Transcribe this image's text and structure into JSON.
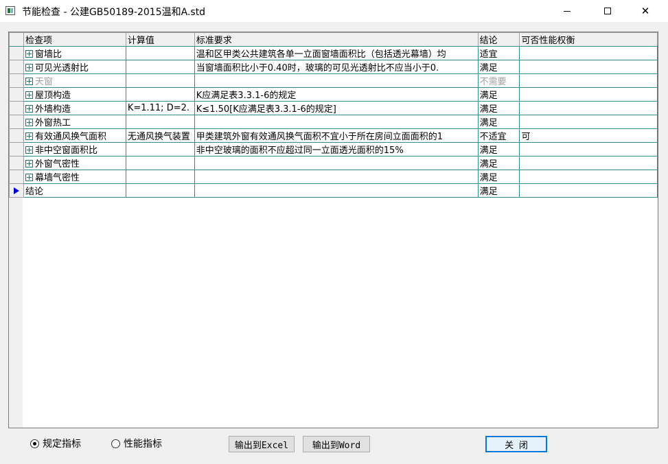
{
  "window": {
    "title": "节能检查 - 公建GB50189-2015温和A.std",
    "minimize_icon": "minimize-icon",
    "maximize_icon": "maximize-icon",
    "close_icon": "close-icon"
  },
  "table": {
    "columns": [
      "检查项",
      "计算值",
      "标准要求",
      "结论",
      "可否性能权衡"
    ],
    "rows": [
      {
        "item": "窗墙比",
        "value": "",
        "requirement": "温和区甲类公共建筑各单一立面窗墙面积比（包括透光幕墙）均",
        "conclusion": "适宜",
        "tradeoff": "",
        "expandable": true,
        "disabled": false,
        "current": false
      },
      {
        "item": "可见光透射比",
        "value": "",
        "requirement": "当窗墙面积比小于0.40时，玻璃的可见光透射比不应当小于0.",
        "conclusion": "满足",
        "tradeoff": "",
        "expandable": true,
        "disabled": false,
        "current": false
      },
      {
        "item": "天窗",
        "value": "",
        "requirement": "",
        "conclusion": "不需要",
        "tradeoff": "",
        "expandable": true,
        "disabled": true,
        "current": false
      },
      {
        "item": "屋顶构造",
        "value": "",
        "requirement": "K应满足表3.3.1-6的规定",
        "conclusion": "满足",
        "tradeoff": "",
        "expandable": true,
        "disabled": false,
        "current": false
      },
      {
        "item": "外墙构造",
        "value": "K=1.11; D=2.",
        "requirement": "K≤1.50[K应满足表3.3.1-6的规定]",
        "conclusion": "满足",
        "tradeoff": "",
        "expandable": true,
        "disabled": false,
        "current": false
      },
      {
        "item": "外窗热工",
        "value": "",
        "requirement": "",
        "conclusion": "满足",
        "tradeoff": "",
        "expandable": true,
        "disabled": false,
        "current": false
      },
      {
        "item": "有效通风换气面积",
        "value": "无通风换气装置",
        "requirement": "甲类建筑外窗有效通风换气面积不宜小于所在房间立面面积的1",
        "conclusion": "不适宜",
        "tradeoff": "可",
        "expandable": true,
        "disabled": false,
        "current": false
      },
      {
        "item": "非中空窗面积比",
        "value": "",
        "requirement": "非中空玻璃的面积不应超过同一立面透光面积的15%",
        "conclusion": "满足",
        "tradeoff": "",
        "expandable": true,
        "disabled": false,
        "current": false
      },
      {
        "item": "外窗气密性",
        "value": "",
        "requirement": "",
        "conclusion": "满足",
        "tradeoff": "",
        "expandable": true,
        "disabled": false,
        "current": false
      },
      {
        "item": "幕墙气密性",
        "value": "",
        "requirement": "",
        "conclusion": "满足",
        "tradeoff": "",
        "expandable": true,
        "disabled": false,
        "current": false
      },
      {
        "item": "结论",
        "value": "",
        "requirement": "",
        "conclusion": "满足",
        "tradeoff": "",
        "expandable": false,
        "disabled": false,
        "current": true
      }
    ]
  },
  "footer": {
    "radio_regulated": "规定指标",
    "radio_performance": "性能指标",
    "selected_radio": "规定指标",
    "export_excel": "输出到Excel",
    "export_word": "输出到Word",
    "close": "关  闭"
  },
  "colors": {
    "grid_line": "#2f8f8f",
    "disabled_text": "#a0a0a0",
    "current_row_arrow": "#0000e0",
    "default_button_border": "#0078d7"
  }
}
